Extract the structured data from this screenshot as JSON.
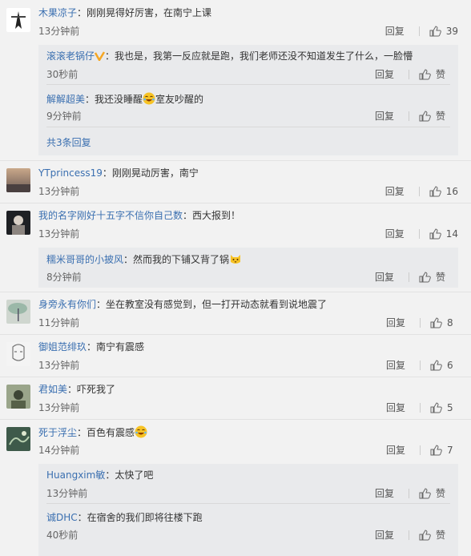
{
  "comments": [
    {
      "user": "木果凉子",
      "text": "：刚刚晃得好厉害，在南宁上课",
      "time": "13分钟前",
      "reply": "回复",
      "likes": "39",
      "subs": [
        {
          "user": "滚滚老锅仔",
          "text": "：我也是，我第一反应就是跑，我们老师还没不知道发生了什么，一脸懵",
          "time": "30秒前",
          "reply": "回复",
          "like": "赞"
        },
        {
          "user": "解解超美",
          "text_a": "：我还没睡醒",
          "text_b": "室友吵醒的",
          "time": "9分钟前",
          "reply": "回复",
          "like": "赞"
        }
      ],
      "more": "共3条回复"
    },
    {
      "user": "YTprincess19",
      "text": "：刚刚晃动厉害，南宁",
      "time": "13分钟前",
      "reply": "回复",
      "likes": "16"
    },
    {
      "user": "我的名字刚好十五字不信你自己数",
      "text": "：西大报到！",
      "time": "13分钟前",
      "reply": "回复",
      "likes": "14",
      "subs": [
        {
          "user": "糯米哥哥的小披风",
          "text": "：然而我的下铺又背了锅",
          "time": "8分钟前",
          "reply": "回复",
          "like": "赞"
        }
      ]
    },
    {
      "user": "身旁永有你们",
      "text": "：坐在教室没有感觉到，但一打开动态就看到说地震了",
      "time": "11分钟前",
      "reply": "回复",
      "likes": "8"
    },
    {
      "user": "御姐范绯玖",
      "text": "：南宁有震感",
      "time": "13分钟前",
      "reply": "回复",
      "likes": "6"
    },
    {
      "user": "君如美",
      "text": "：吓死我了",
      "time": "13分钟前",
      "reply": "回复",
      "likes": "5"
    },
    {
      "user": "死于浮尘",
      "text": "：百色有震感",
      "time": "14分钟前",
      "reply": "回复",
      "likes": "7",
      "subs": [
        {
          "user": "Huangxim敏",
          "text": "：太快了吧",
          "time": "13分钟前",
          "reply": "回复",
          "like": "赞"
        },
        {
          "user": "诚DHC",
          "text": "：在宿舍的我们即将往楼下跑",
          "time": "40秒前",
          "reply": "回复",
          "like": "赞"
        }
      ]
    }
  ],
  "colors": {
    "link": "#3a6fb0",
    "bg": "#f2f2f2",
    "subbg": "#e9eaec",
    "vbadge": "#f5a623"
  }
}
